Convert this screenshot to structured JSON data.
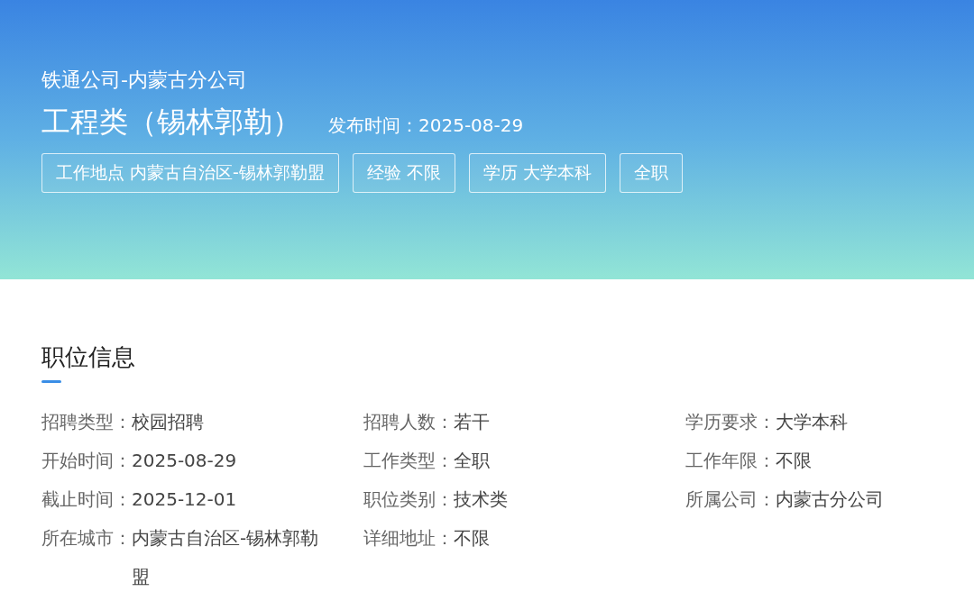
{
  "header": {
    "company": "铁通公司-内蒙古分公司",
    "title": "工程类（锡林郭勒）",
    "publish_time": "发布时间：2025-08-29",
    "tags": [
      "工作地点 内蒙古自治区-锡林郭勒盟",
      "经验 不限",
      "学历 大学本科",
      "全职"
    ]
  },
  "section": {
    "title": "职位信息",
    "fields": [
      {
        "label": "招聘类型：",
        "value": "校园招聘"
      },
      {
        "label": "招聘人数：",
        "value": "若干"
      },
      {
        "label": "学历要求：",
        "value": "大学本科"
      },
      {
        "label": "开始时间：",
        "value": "2025-08-29"
      },
      {
        "label": "工作类型：",
        "value": "全职"
      },
      {
        "label": "工作年限：",
        "value": "不限"
      },
      {
        "label": "截止时间：",
        "value": "2025-12-01"
      },
      {
        "label": "职位类别：",
        "value": "技术类"
      },
      {
        "label": "所属公司：",
        "value": "内蒙古分公司"
      },
      {
        "label": "所在城市：",
        "value": "内蒙古自治区-锡林郭勒盟"
      },
      {
        "label": "详细地址：",
        "value": "不限"
      }
    ]
  }
}
